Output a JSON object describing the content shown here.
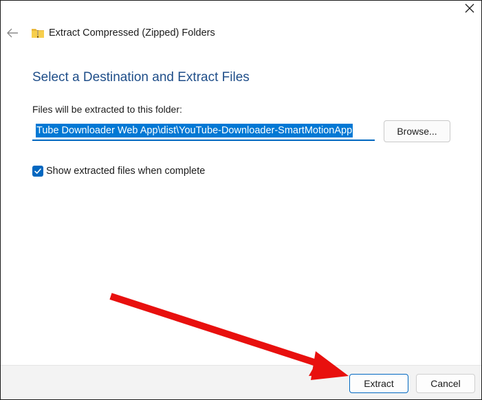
{
  "window": {
    "title": "Extract Compressed (Zipped) Folders"
  },
  "icons": {
    "close": "close-icon",
    "back": "back-arrow-icon",
    "folder": "zip-folder-icon",
    "check": "checkmark-icon",
    "annotation": "red-arrow-annotation"
  },
  "main": {
    "heading": "Select a Destination and Extract Files",
    "path_label": "Files will be extracted to this folder:",
    "path_value": "Tube Downloader Web App\\dist\\YouTube-Downloader-SmartMotionApp",
    "browse_label": "Browse...",
    "show_files_label": "Show extracted files when complete",
    "show_files_checked": true
  },
  "footer": {
    "extract_label": "Extract",
    "cancel_label": "Cancel"
  },
  "colors": {
    "accent": "#0067c0",
    "heading": "#1f4e89",
    "selection": "#0078d4",
    "annotation": "#e8100e"
  }
}
